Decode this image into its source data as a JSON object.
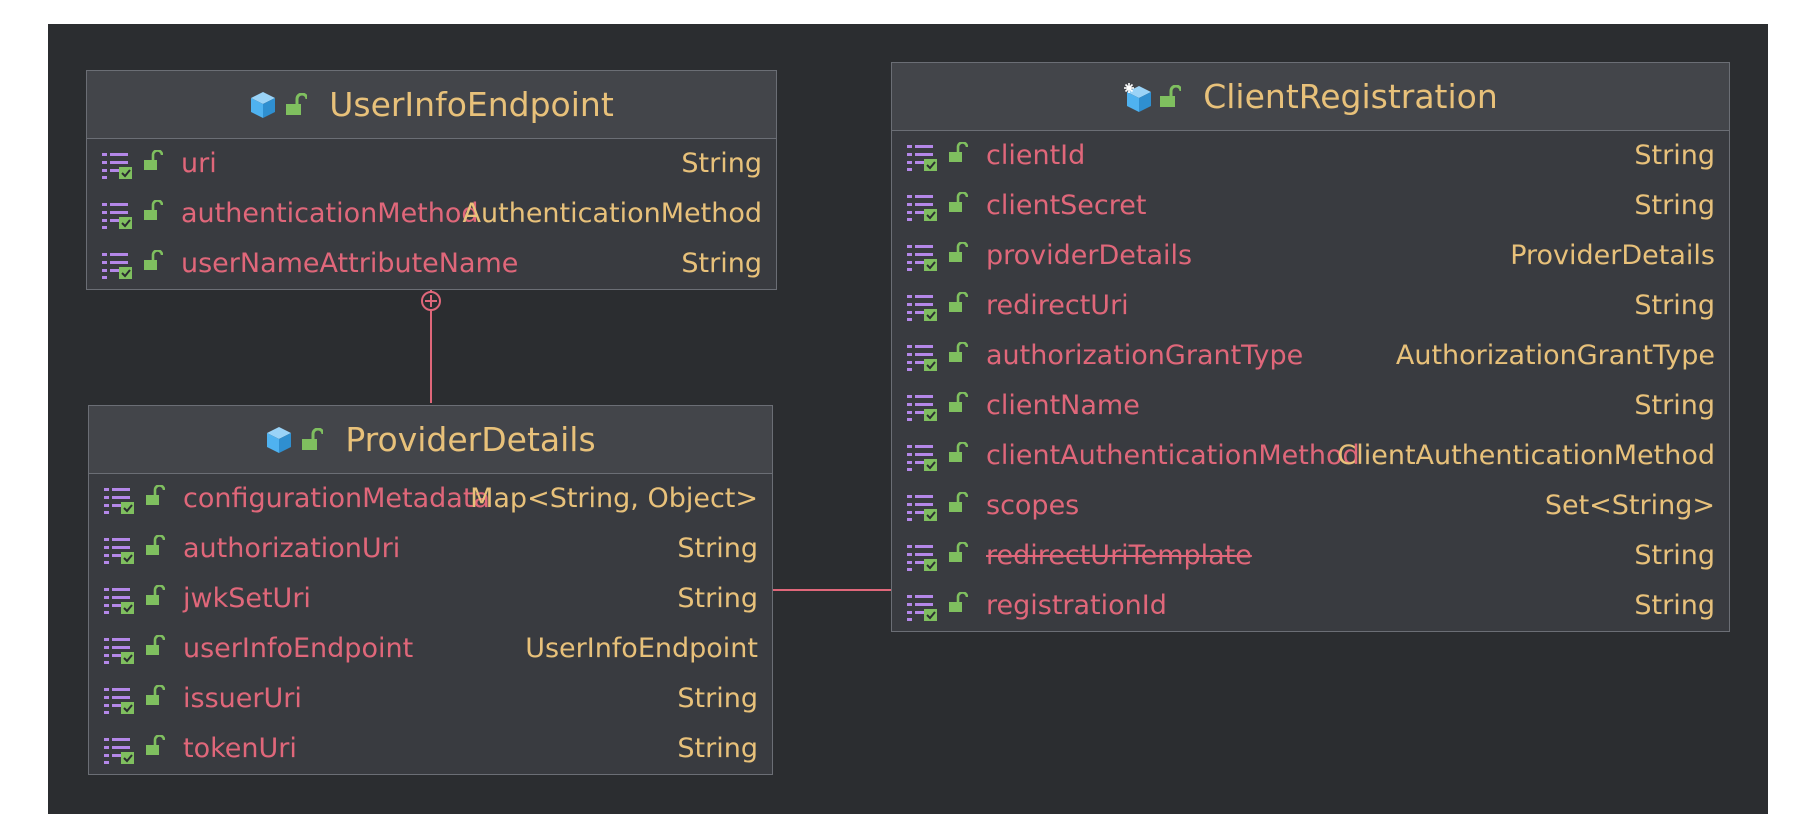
{
  "colors": {
    "background": "#2b2d30",
    "class_body": "#393b40",
    "class_header": "#43454a",
    "border": "#6b6e75",
    "title_text": "#e8c17a",
    "field_name": "#e0677a",
    "field_type": "#e8c17a",
    "connector": "#e0677a",
    "class_icon": "#4fb2f0",
    "visibility_icon": "#7fbf5f",
    "field_list_icon": "#b487e8"
  },
  "classes": {
    "user_info_endpoint": {
      "name": "UserInfoEndpoint",
      "icon": "class-cube-icon",
      "fields": [
        {
          "name": "uri",
          "type": "String"
        },
        {
          "name": "authenticationMethod",
          "type": "AuthenticationMethod"
        },
        {
          "name": "userNameAttributeName",
          "type": "String"
        }
      ]
    },
    "provider_details": {
      "name": "ProviderDetails",
      "icon": "class-cube-icon",
      "fields": [
        {
          "name": "configurationMetadata",
          "type": "Map<String, Object>"
        },
        {
          "name": "authorizationUri",
          "type": "String"
        },
        {
          "name": "jwkSetUri",
          "type": "String"
        },
        {
          "name": "userInfoEndpoint",
          "type": "UserInfoEndpoint"
        },
        {
          "name": "issuerUri",
          "type": "String"
        },
        {
          "name": "tokenUri",
          "type": "String"
        }
      ]
    },
    "client_registration": {
      "name": "ClientRegistration",
      "icon": "class-cube-star-icon",
      "fields": [
        {
          "name": "clientId",
          "type": "String"
        },
        {
          "name": "clientSecret",
          "type": "String"
        },
        {
          "name": "providerDetails",
          "type": "ProviderDetails"
        },
        {
          "name": "redirectUri",
          "type": "String"
        },
        {
          "name": "authorizationGrantType",
          "type": "AuthorizationGrantType"
        },
        {
          "name": "clientName",
          "type": "String"
        },
        {
          "name": "clientAuthenticationMethod",
          "type": "ClientAuthenticationMethod"
        },
        {
          "name": "scopes",
          "type": "Set<String>"
        },
        {
          "name": "redirectUriTemplate",
          "type": "String",
          "deprecated": true
        },
        {
          "name": "registrationId",
          "type": "String"
        }
      ]
    }
  },
  "connectors": [
    {
      "from": "ProviderDetails",
      "to": "UserInfoEndpoint",
      "kind": "inner-class"
    },
    {
      "from": "ClientRegistration",
      "to": "ProviderDetails",
      "kind": "inner-class"
    }
  ]
}
